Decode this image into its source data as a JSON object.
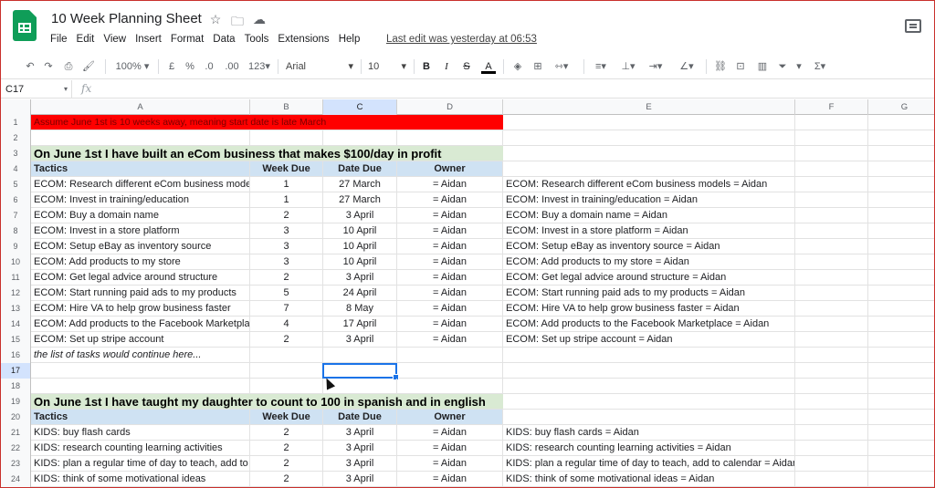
{
  "app": {
    "doc_title": "10 Week Planning Sheet",
    "last_edit": "Last edit was yesterday at 06:53",
    "menu": [
      "File",
      "Edit",
      "View",
      "Insert",
      "Format",
      "Data",
      "Tools",
      "Extensions",
      "Help"
    ]
  },
  "toolbar": {
    "zoom": "100%",
    "currency": "£",
    "percent": "%",
    "dec_less": ".0",
    "dec_more": ".00",
    "more_formats": "123",
    "font": "Arial",
    "font_size": "10",
    "bold": "B",
    "italic": "I",
    "strike": "S",
    "text_color": "A"
  },
  "formula_bar": {
    "cell_ref": "C17",
    "fx": "fx",
    "value": ""
  },
  "columns": [
    "A",
    "B",
    "C",
    "D",
    "E",
    "F",
    "G"
  ],
  "selected_column": "C",
  "selected_row": "17",
  "rows": [
    {
      "n": "1",
      "banner": "red",
      "text": "Assume June 1st is 10 weeks away, meaning start date is late March"
    },
    {
      "n": "2"
    },
    {
      "n": "3",
      "banner": "green",
      "text": "On June 1st I have built an eCom business that makes $100/day in profit"
    },
    {
      "n": "4",
      "header": true,
      "a": "Tactics",
      "b": "Week Due",
      "c": "Date Due",
      "d": "Owner"
    },
    {
      "n": "5",
      "a": "ECOM: Research different eCom business models",
      "b": "1",
      "c": "27 March",
      "d": "= Aidan",
      "e": "ECOM: Research different eCom business models = Aidan"
    },
    {
      "n": "6",
      "a": "ECOM: Invest in training/education",
      "b": "1",
      "c": "27 March",
      "d": "= Aidan",
      "e": "ECOM: Invest in training/education = Aidan"
    },
    {
      "n": "7",
      "a": "ECOM: Buy a domain name",
      "b": "2",
      "c": "3 April",
      "d": "= Aidan",
      "e": "ECOM: Buy a domain name = Aidan"
    },
    {
      "n": "8",
      "a": "ECOM: Invest in a store platform",
      "b": "3",
      "c": "10 April",
      "d": "= Aidan",
      "e": "ECOM: Invest in a store platform = Aidan"
    },
    {
      "n": "9",
      "a": "ECOM: Setup eBay as inventory source",
      "b": "3",
      "c": "10 April",
      "d": "= Aidan",
      "e": "ECOM: Setup eBay as inventory source = Aidan"
    },
    {
      "n": "10",
      "a": "ECOM: Add products to my store",
      "b": "3",
      "c": "10 April",
      "d": "= Aidan",
      "e": "ECOM: Add products to my store = Aidan"
    },
    {
      "n": "11",
      "a": "ECOM: Get legal advice around structure",
      "b": "2",
      "c": "3 April",
      "d": "= Aidan",
      "e": "ECOM: Get legal advice around structure = Aidan"
    },
    {
      "n": "12",
      "a": "ECOM: Start running paid ads to my products",
      "b": "5",
      "c": "24 April",
      "d": "= Aidan",
      "e": "ECOM: Start running paid ads to my products = Aidan"
    },
    {
      "n": "13",
      "a": "ECOM: Hire VA to help grow business faster",
      "b": "7",
      "c": "8 May",
      "d": "= Aidan",
      "e": "ECOM: Hire VA to help grow business faster = Aidan"
    },
    {
      "n": "14",
      "a": "ECOM: Add products to the Facebook Marketplace",
      "b": "4",
      "c": "17 April",
      "d": "= Aidan",
      "e": "ECOM: Add products to the Facebook Marketplace = Aidan"
    },
    {
      "n": "15",
      "a": "ECOM: Set up stripe account",
      "b": "2",
      "c": "3 April",
      "d": "= Aidan",
      "e": "ECOM: Set up stripe account = Aidan"
    },
    {
      "n": "16",
      "a": "the list of tasks would continue here...",
      "italic": true
    },
    {
      "n": "17"
    },
    {
      "n": "18"
    },
    {
      "n": "19",
      "banner": "green",
      "text": "On June 1st I have taught my daughter to count to 100 in spanish and in english"
    },
    {
      "n": "20",
      "header": true,
      "a": "Tactics",
      "b": "Week Due",
      "c": "Date Due",
      "d": "Owner"
    },
    {
      "n": "21",
      "a": "KIDS: buy flash cards",
      "b": "2",
      "c": "3 April",
      "d": "= Aidan",
      "e": "KIDS: buy flash cards = Aidan"
    },
    {
      "n": "22",
      "a": "KIDS: research counting learning activities",
      "b": "2",
      "c": "3 April",
      "d": "= Aidan",
      "e": "KIDS: research counting learning activities = Aidan"
    },
    {
      "n": "23",
      "a": "KIDS: plan a regular time of day to teach, add to calendar",
      "b": "2",
      "c": "3 April",
      "d": "= Aidan",
      "e": "KIDS: plan a regular time of day to teach, add to calendar = Aidan"
    },
    {
      "n": "24",
      "a": "KIDS: think of some motivational ideas",
      "b": "2",
      "c": "3 April",
      "d": "= Aidan",
      "e": "KIDS: think of some motivational ideas = Aidan"
    }
  ]
}
